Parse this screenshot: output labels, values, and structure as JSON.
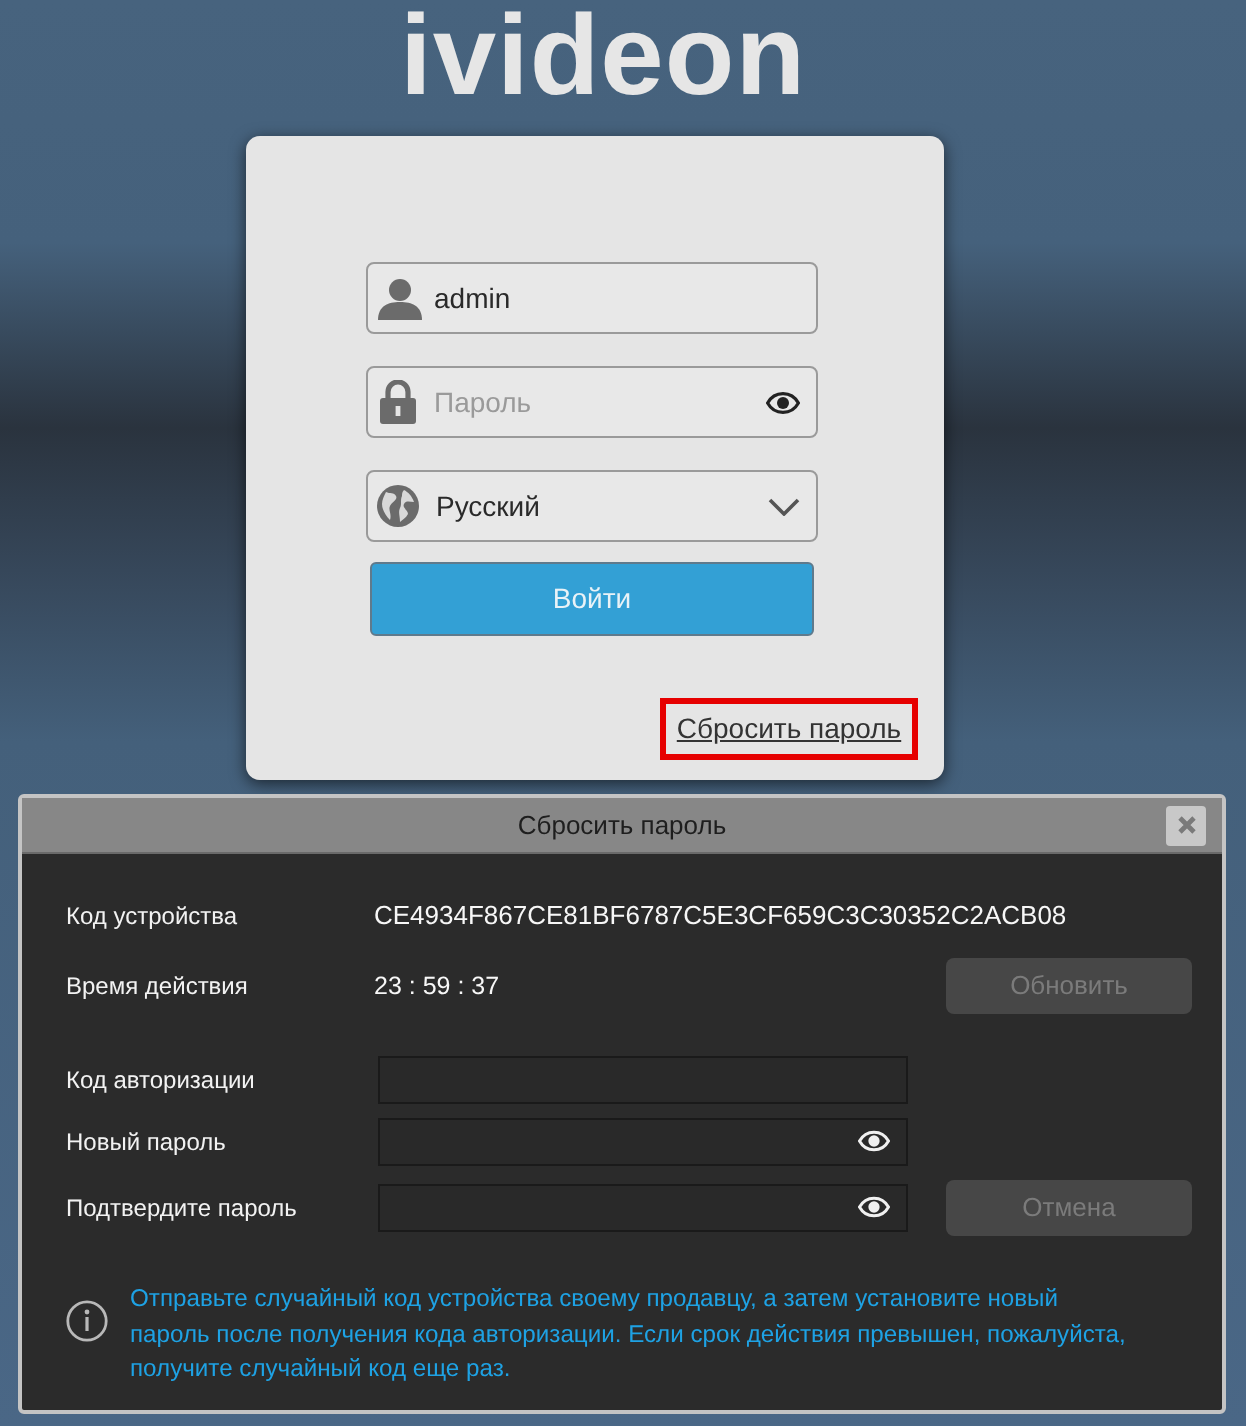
{
  "logo": {
    "text": "ivideon"
  },
  "login": {
    "username": {
      "value": "admin"
    },
    "password": {
      "placeholder": "Пароль"
    },
    "language": {
      "value": "Русский"
    },
    "submit_button": {
      "label": "Войти"
    },
    "reset_link": {
      "label": "Сбросить пароль",
      "highlighted": true
    }
  },
  "dialog": {
    "title": "Сбросить пароль",
    "info_rows": [
      {
        "label": "Код устройства",
        "value": "CE4934F867CE81BF6787C5E3CF659C3C30352C2ACB08"
      },
      {
        "label": "Время действия",
        "value": "23 : 59 : 37",
        "button": {
          "label": "Обновить",
          "disabled": true
        }
      }
    ],
    "fields": [
      {
        "label": "Код авторизации",
        "kind": "text"
      },
      {
        "label": "Новый пароль",
        "kind": "password"
      },
      {
        "label": "Подтвердите пароль",
        "kind": "password",
        "button": {
          "label": "Отмена",
          "disabled": true
        }
      }
    ],
    "note": "Отправьте случайный код устройства своему продавцу, а затем установите новый пароль после получения кода авторизации. Если срок действия превышен, пожалуйста, получите случайный код еще раз."
  }
}
